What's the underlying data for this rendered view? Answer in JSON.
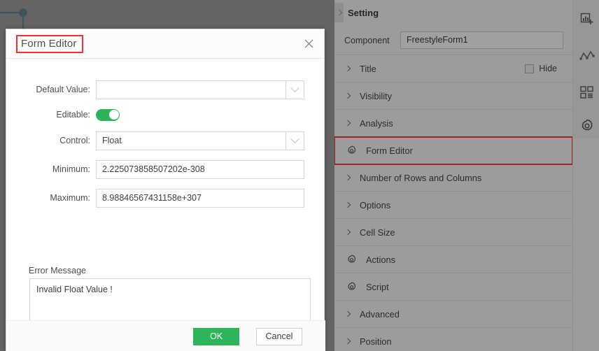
{
  "dialog": {
    "title": "Form Editor",
    "close_icon": "close-icon",
    "fields": [
      {
        "label": "Default Value:",
        "value": "",
        "type": "combo"
      },
      {
        "label": "Editable:",
        "value": "on",
        "type": "toggle"
      },
      {
        "label": "Control:",
        "value": "Float",
        "type": "combo"
      },
      {
        "label": "Minimum:",
        "value": "2.225073858507202e-308",
        "type": "text"
      },
      {
        "label": "Maximum:",
        "value": "8.98846567431158e+307",
        "type": "text"
      }
    ],
    "error_message_label": "Error Message",
    "error_message_value": "Invalid Float Value !",
    "ok_label": "OK",
    "cancel_label": "Cancel",
    "accent_green": "#2eb558",
    "highlight_red": "#f4312f"
  },
  "setting_panel": {
    "title": "Setting",
    "collapse_icon": "chevron-right-icon",
    "component_label": "Component",
    "component_value": "FreestyleForm1",
    "hide_label": "Hide",
    "hide_checked": false,
    "items": [
      {
        "label": "Title",
        "icon": "chevron-right-icon",
        "has_hide": true,
        "highlighted": false
      },
      {
        "label": "Visibility",
        "icon": "chevron-right-icon",
        "has_hide": false,
        "highlighted": false
      },
      {
        "label": "Analysis",
        "icon": "chevron-right-icon",
        "has_hide": false,
        "highlighted": false
      },
      {
        "label": "Form Editor",
        "icon": "gear-icon",
        "has_hide": false,
        "highlighted": true
      },
      {
        "label": "Number of Rows and Columns",
        "icon": "chevron-right-icon",
        "has_hide": false,
        "highlighted": false
      },
      {
        "label": "Options",
        "icon": "chevron-right-icon",
        "has_hide": false,
        "highlighted": false
      },
      {
        "label": "Cell Size",
        "icon": "chevron-right-icon",
        "has_hide": false,
        "highlighted": false
      },
      {
        "label": "Actions",
        "icon": "gear-icon",
        "has_hide": false,
        "highlighted": false
      },
      {
        "label": "Script",
        "icon": "gear-icon",
        "has_hide": false,
        "highlighted": false
      },
      {
        "label": "Advanced",
        "icon": "chevron-right-icon",
        "has_hide": false,
        "highlighted": false
      },
      {
        "label": "Position",
        "icon": "chevron-right-icon",
        "has_hide": false,
        "highlighted": false
      }
    ]
  },
  "icon_rail": {
    "buttons": [
      {
        "name": "add-chart-icon"
      },
      {
        "name": "line-chart-icon"
      },
      {
        "name": "layout-grid-icon"
      },
      {
        "name": "gear-icon"
      }
    ]
  }
}
